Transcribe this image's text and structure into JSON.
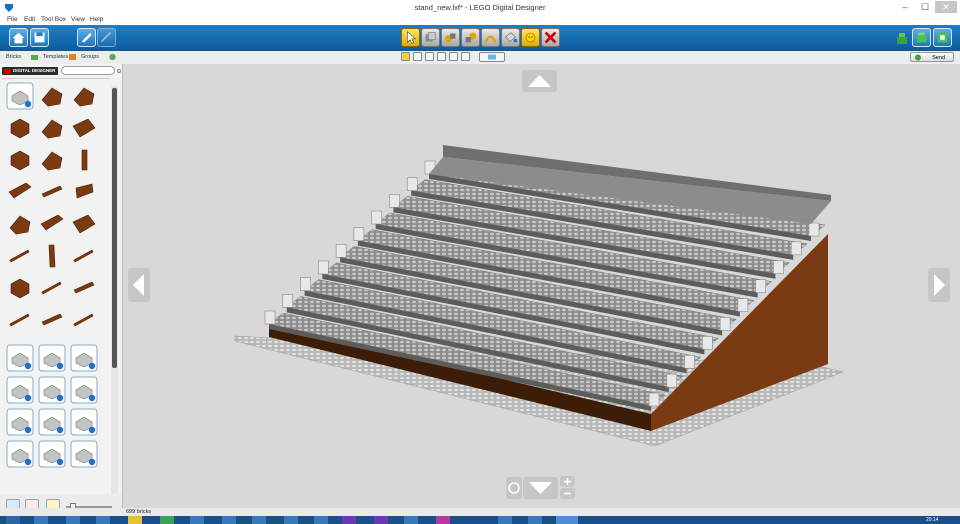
{
  "window": {
    "title": "stand_new.lxf* - LEGO Digital Designer",
    "minimize": "–",
    "maximize": "☐",
    "close": "✕"
  },
  "menu": [
    "File",
    "Edit",
    "Tool Box",
    "View",
    "Help"
  ],
  "subbar": {
    "tabs": [
      "Bricks",
      "Templates",
      "Groups"
    ],
    "send_label": "Send"
  },
  "palette": {
    "brand": "DIGITAL DESIGNER"
  },
  "status": {
    "brick_count": "699 bricks"
  },
  "taskbar": {
    "clock": "20:14"
  },
  "colors": {
    "toolbar": "#1a72ba",
    "brick_brown": "#7a3a12",
    "plate_gray": "#9a9a9a",
    "viewport": "#d8d8d8"
  }
}
